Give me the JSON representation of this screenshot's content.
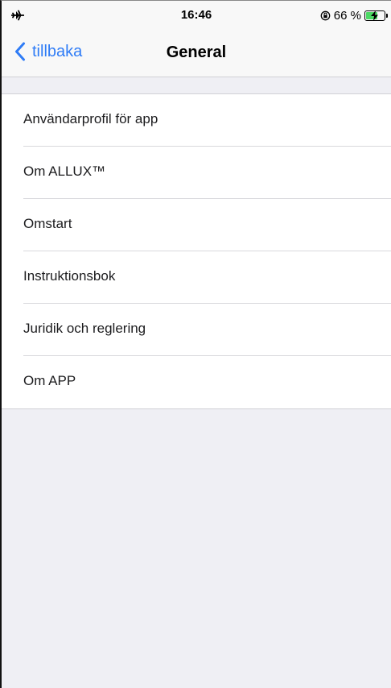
{
  "status_bar": {
    "time": "16:46",
    "battery_percent": "66 %",
    "icons": [
      "airplane-mode-icon",
      "orientation-lock-icon",
      "battery-charging-icon"
    ],
    "battery_level": 0.66,
    "battery_color": "#4cd964"
  },
  "nav": {
    "back_label": "tillbaka",
    "title": "General",
    "accent_color": "#2f7cf6",
    "back_icon": "chevron-left-icon"
  },
  "menu": {
    "items": [
      {
        "label": "Användarprofil för app"
      },
      {
        "label": "Om ALLUX™"
      },
      {
        "label": "Omstart"
      },
      {
        "label": "Instruktionsbok"
      },
      {
        "label": "Juridik och reglering"
      },
      {
        "label": "Om APP"
      }
    ]
  }
}
